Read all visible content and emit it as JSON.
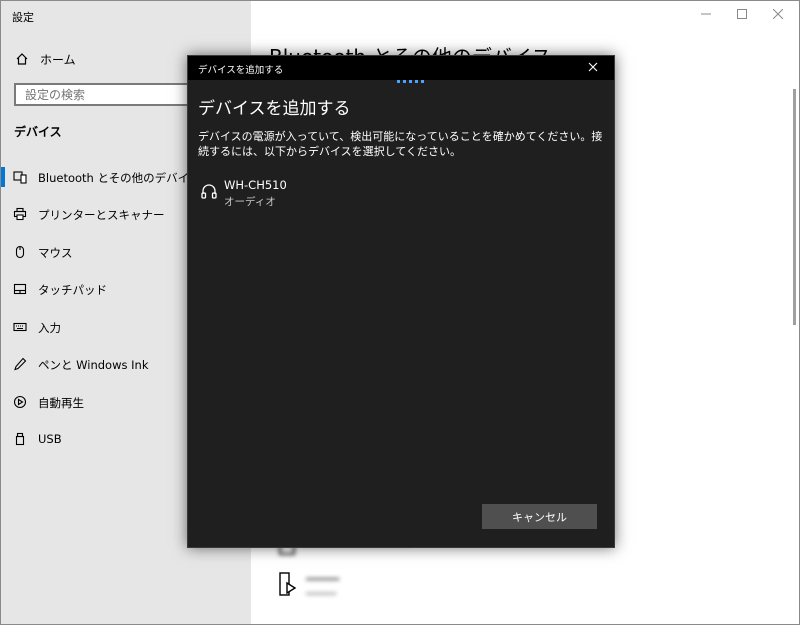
{
  "window": {
    "title": "設定"
  },
  "sidebar": {
    "home_label": "ホーム",
    "search_placeholder": "設定の検索",
    "section_title": "デバイス",
    "items": [
      {
        "label": "Bluetooth とその他のデバイス",
        "icon": "bluetooth-device-icon",
        "active": true
      },
      {
        "label": "プリンターとスキャナー",
        "icon": "printer-icon",
        "active": false
      },
      {
        "label": "マウス",
        "icon": "mouse-icon",
        "active": false
      },
      {
        "label": "タッチパッド",
        "icon": "touchpad-icon",
        "active": false
      },
      {
        "label": "入力",
        "icon": "keyboard-icon",
        "active": false
      },
      {
        "label": "ペンと Windows Ink",
        "icon": "pen-icon",
        "active": false
      },
      {
        "label": "自動再生",
        "icon": "autoplay-icon",
        "active": false
      },
      {
        "label": "USB",
        "icon": "usb-icon",
        "active": false
      }
    ]
  },
  "main": {
    "page_title": "Bluetooth とその他のデバイス"
  },
  "dialog": {
    "titlebar": "デバイスを追加する",
    "heading": "デバイスを追加する",
    "description": "デバイスの電源が入っていて、検出可能になっていることを確かめてください。接続するには、以下からデバイスを選択してください。",
    "device": {
      "name": "WH-CH510",
      "type": "オーディオ",
      "icon": "headset-icon"
    },
    "cancel_label": "キャンセル"
  },
  "colors": {
    "accent": "#0078d7",
    "dialog_bg": "#1f1f1f",
    "sidebar_bg": "#e6e6e6"
  }
}
